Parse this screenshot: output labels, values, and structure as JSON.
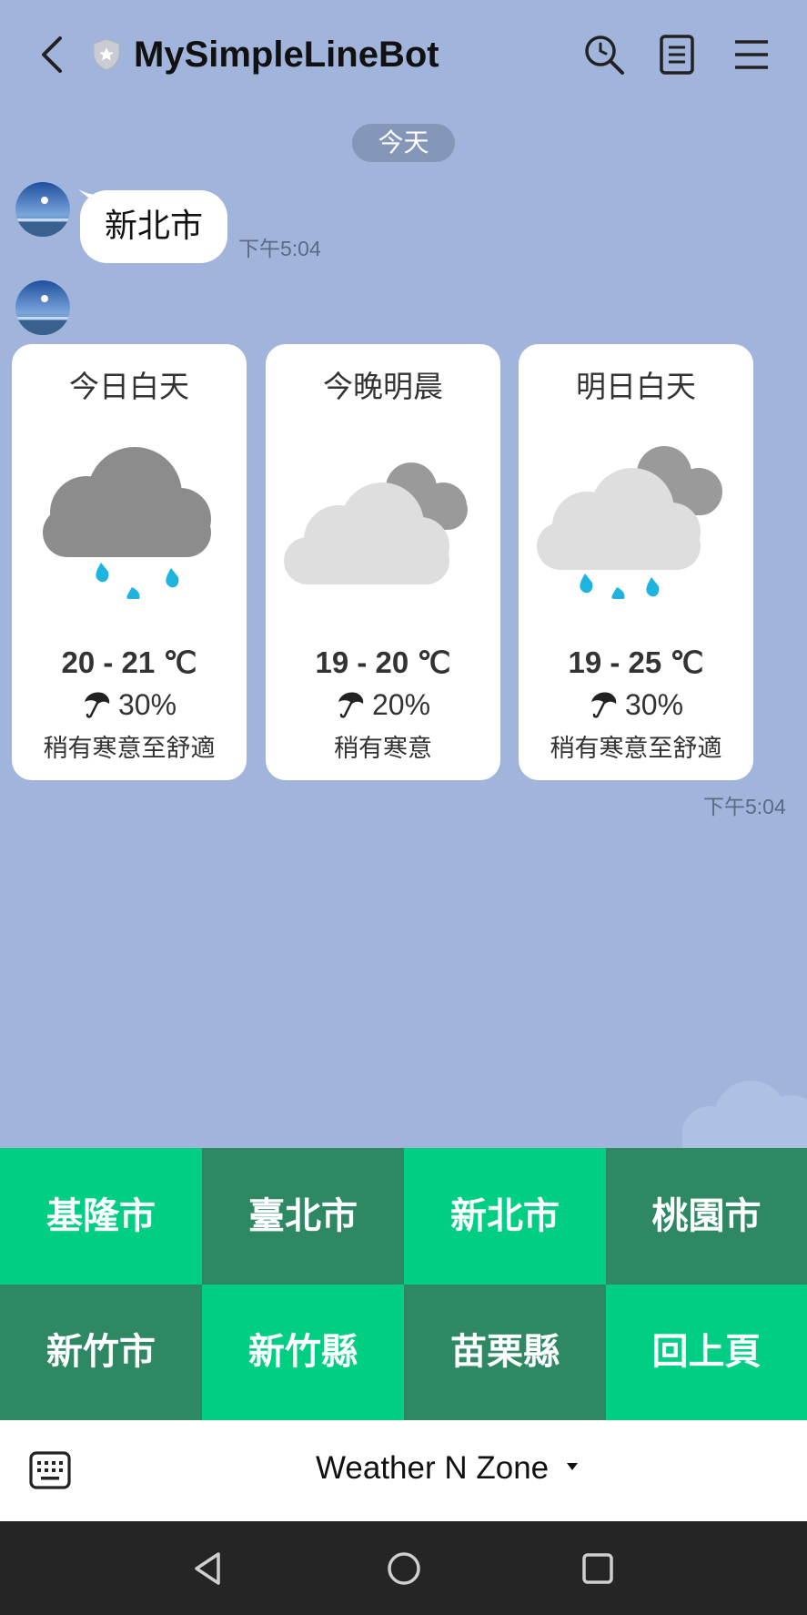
{
  "header": {
    "title": "MySimpleLineBot",
    "icons": [
      "back-icon",
      "shield-icon",
      "search-icon",
      "notes-icon",
      "menu-icon"
    ]
  },
  "chat": {
    "date_label": "今天",
    "messages": [
      {
        "type": "text",
        "text": "新北市",
        "time": "下午5:04"
      },
      {
        "type": "weather-carousel",
        "time": "下午5:04",
        "cards": [
          {
            "period": "今日白天",
            "icon": "rain-icon",
            "temp": "20 - 21 ℃",
            "rain": "30%",
            "comfort": "稍有寒意至舒適"
          },
          {
            "period": "今晚明晨",
            "icon": "cloudy-icon",
            "temp": "19 - 20 ℃",
            "rain": "20%",
            "comfort": "稍有寒意"
          },
          {
            "period": "明日白天",
            "icon": "cloudy-rain-icon",
            "temp": "19 - 25 ℃",
            "rain": "30%",
            "comfort": "稍有寒意至舒適"
          }
        ]
      }
    ]
  },
  "rich_menu": {
    "items": [
      "基隆市",
      "臺北市",
      "新北市",
      "桃園市",
      "新竹市",
      "新竹縣",
      "苗栗縣",
      "回上頁"
    ],
    "colors": {
      "light": "#00ce82",
      "dark": "#2d8863"
    }
  },
  "bottom_bar": {
    "menu_name": "Weather N Zone"
  },
  "colors": {
    "background": "#a1b5dc",
    "date_pill": "#8597b8"
  }
}
